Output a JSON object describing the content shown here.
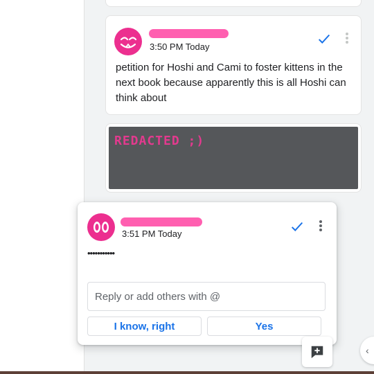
{
  "comments": [
    {
      "timestamp": "3:50 PM Today",
      "text": "petition for Hoshi and Cami to foster kittens in the next book because apparently this is all Hoshi can think about",
      "avatar_icon": "pink-smiling-face-avatar",
      "resolve_icon": "check-icon",
      "more_icon": "more-vert-icon"
    },
    {
      "image_text": "REDACTED ;)"
    },
    {
      "timestamp": "3:51 PM Today",
      "text": "•••••••••••",
      "avatar_icon": "pink-eyes-avatar",
      "resolve_icon": "check-icon",
      "more_icon": "more-vert-icon"
    }
  ],
  "reply": {
    "placeholder": "Reply or add others with @",
    "value": ""
  },
  "smart_replies": [
    "I know, right",
    "Yes"
  ],
  "add_comment_icon": "add-comment-icon",
  "colors": {
    "accent": "#1a73e8",
    "avatar_pink": "#ec2f8f",
    "name_redaction_pink": "#ff5fb0",
    "redacted_image_bg": "#55575a"
  }
}
